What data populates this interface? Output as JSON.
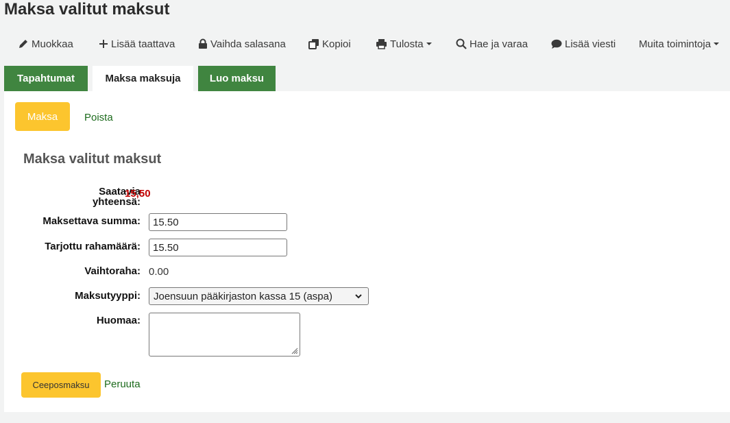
{
  "page": {
    "title": "Maksa valitut maksut"
  },
  "toolbar": {
    "edit": "Muokkaa",
    "add_guarantor": "Lisää taattava",
    "change_password": "Vaihda salasana",
    "copy": "Kopioi",
    "print": "Tulosta",
    "search_reserve": "Hae ja varaa",
    "add_message": "Lisää viesti",
    "more_actions": "Muita toimintoja"
  },
  "tabs": [
    {
      "label": "Tapahtumat",
      "active": false
    },
    {
      "label": "Maksa maksuja",
      "active": true
    },
    {
      "label": "Luo maksu",
      "active": false
    }
  ],
  "actions": {
    "pay": "Maksa",
    "delete": "Poista"
  },
  "form": {
    "title": "Maksa valitut maksut",
    "total_label": "Saatavia yhteensä:",
    "total_value": "15,50",
    "amount_label": "Maksettava summa:",
    "amount_value": "15.50",
    "tendered_label": "Tarjottu rahamäärä:",
    "tendered_value": "15.50",
    "change_label": "Vaihtoraha:",
    "change_value": "0.00",
    "payment_type_label": "Maksutyyppi:",
    "payment_type_value": "Joensuun pääkirjaston kassa 15 (aspa)",
    "note_label": "Huomaa:",
    "note_value": "",
    "submit": "Ceeposmaksu",
    "cancel": "Peruuta"
  },
  "colors": {
    "accent_green": "#408540",
    "link_green": "#1d6b1d",
    "button_yellow": "#fcc52e",
    "amount_red": "#c00000"
  }
}
